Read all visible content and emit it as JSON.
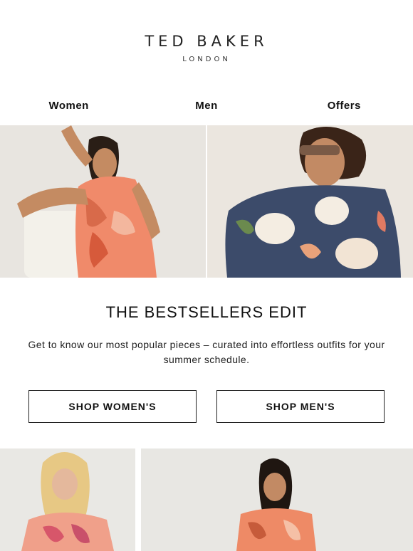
{
  "brand": {
    "name": "TED BAKER",
    "sub": "LONDON"
  },
  "nav": {
    "women": "Women",
    "men": "Men",
    "offers": "Offers"
  },
  "hero": {
    "left_alt": "Woman in coral floral dress",
    "right_alt": "Man in floral print t-shirt with sunglasses"
  },
  "edit": {
    "title": "THE BESTSELLERS EDIT",
    "copy": "Get to know our most popular pieces – curated into effortless outfits for your summer schedule."
  },
  "buttons": {
    "women": "SHOP WOMEN'S",
    "men": "SHOP MEN'S"
  },
  "colors": {
    "accent_coral": "#f08a6a",
    "text": "#111111"
  }
}
